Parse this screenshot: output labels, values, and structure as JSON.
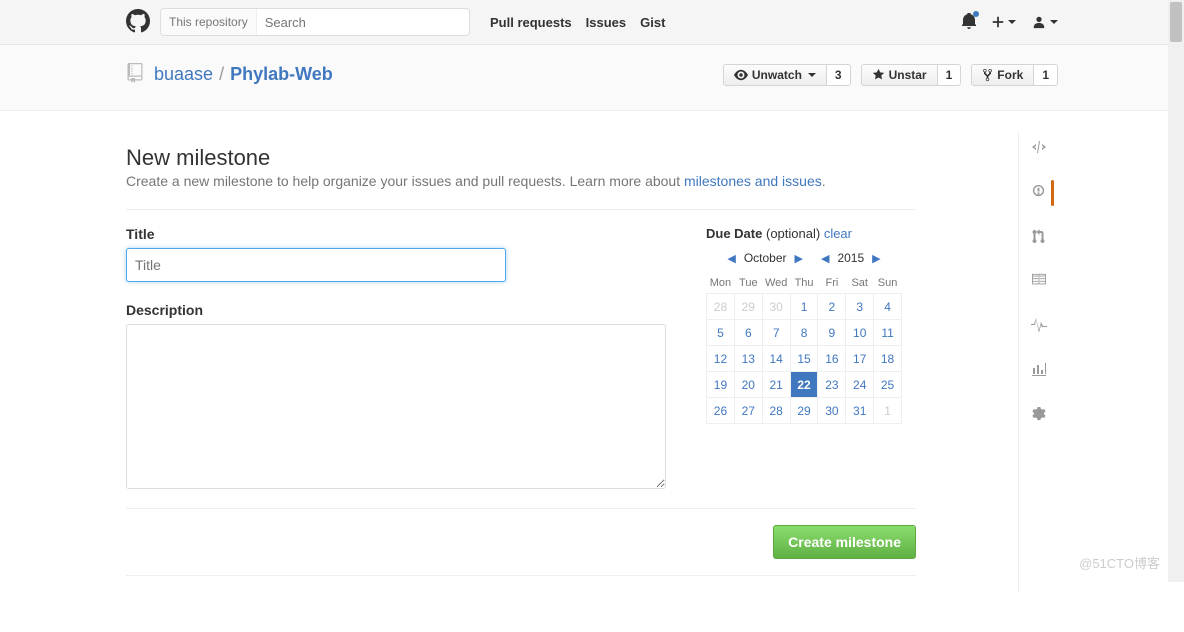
{
  "header": {
    "search_scope": "This repository",
    "search_placeholder": "Search",
    "nav": {
      "pulls": "Pull requests",
      "issues": "Issues",
      "gist": "Gist"
    }
  },
  "repo": {
    "owner": "buaase",
    "name": "Phylab-Web",
    "watch": {
      "label": "Unwatch",
      "count": "3"
    },
    "star": {
      "label": "Unstar",
      "count": "1"
    },
    "fork": {
      "label": "Fork",
      "count": "1"
    }
  },
  "page": {
    "title": "New milestone",
    "subtitle_pre": "Create a new milestone to help organize your issues and pull requests. Learn more about ",
    "subtitle_link": "milestones and issues",
    "subtitle_post": ".",
    "title_label": "Title",
    "title_placeholder": "Title",
    "desc_label": "Description",
    "due_label": "Due Date",
    "due_optional": "(optional)",
    "clear": "clear",
    "create_btn": "Create milestone"
  },
  "calendar": {
    "month": "October",
    "year": "2015",
    "dow": [
      "Mon",
      "Tue",
      "Wed",
      "Thu",
      "Fri",
      "Sat",
      "Sun"
    ],
    "weeks": [
      [
        {
          "d": "28",
          "m": true
        },
        {
          "d": "29",
          "m": true
        },
        {
          "d": "30",
          "m": true
        },
        {
          "d": "1"
        },
        {
          "d": "2"
        },
        {
          "d": "3"
        },
        {
          "d": "4"
        }
      ],
      [
        {
          "d": "5"
        },
        {
          "d": "6"
        },
        {
          "d": "7"
        },
        {
          "d": "8"
        },
        {
          "d": "9"
        },
        {
          "d": "10"
        },
        {
          "d": "11"
        }
      ],
      [
        {
          "d": "12"
        },
        {
          "d": "13"
        },
        {
          "d": "14"
        },
        {
          "d": "15"
        },
        {
          "d": "16"
        },
        {
          "d": "17"
        },
        {
          "d": "18"
        }
      ],
      [
        {
          "d": "19"
        },
        {
          "d": "20"
        },
        {
          "d": "21"
        },
        {
          "d": "22",
          "sel": true
        },
        {
          "d": "23"
        },
        {
          "d": "24"
        },
        {
          "d": "25"
        }
      ],
      [
        {
          "d": "26"
        },
        {
          "d": "27"
        },
        {
          "d": "28"
        },
        {
          "d": "29"
        },
        {
          "d": "30"
        },
        {
          "d": "31"
        },
        {
          "d": "1",
          "m": true
        }
      ]
    ]
  },
  "watermark": "@51CTO博客"
}
